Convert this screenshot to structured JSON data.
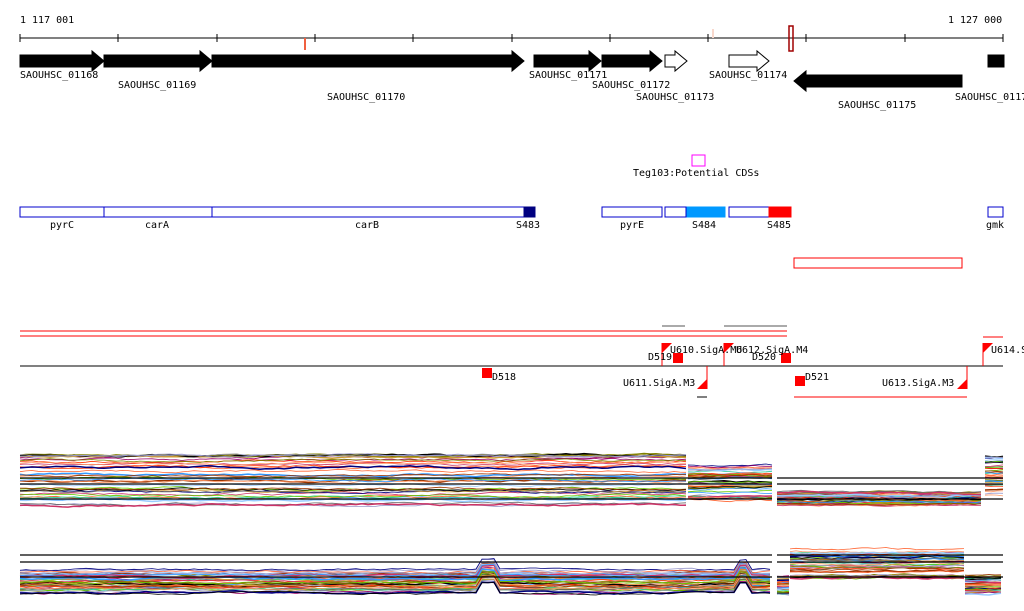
{
  "ruler": {
    "start_label": "1 117 001",
    "end_label": "1 127 000"
  },
  "genes": [
    {
      "label": "SAOUHSC_01168"
    },
    {
      "label": "SAOUHSC_01169"
    },
    {
      "label": "SAOUHSC_01170"
    },
    {
      "label": "SAOUHSC_01171"
    },
    {
      "label": "SAOUHSC_01172"
    },
    {
      "label": "SAOUHSC_01173"
    },
    {
      "label": "SAOUHSC_01174"
    },
    {
      "label": "SAOUHSC_01175"
    },
    {
      "label": "SAOUHSC_0117"
    }
  ],
  "annotation": {
    "label": "Teg103:Potential CDSs",
    "color": "#ff00ff"
  },
  "operons": [
    {
      "label": "pyrC"
    },
    {
      "label": "carA"
    },
    {
      "label": "carB"
    },
    {
      "label": "S483",
      "color": "#000080"
    },
    {
      "label": "pyrE"
    },
    {
      "label": ""
    },
    {
      "label": "S484",
      "color": "#0099ff"
    },
    {
      "label": ""
    },
    {
      "label": "S485",
      "color": "#ff0000"
    },
    {
      "label": "gmk"
    }
  ],
  "features": [
    {
      "label": "D518"
    },
    {
      "label": "D519"
    },
    {
      "label": "U610.SigA.M6"
    },
    {
      "label": "U611.SigA.M3"
    },
    {
      "label": "U612.SigA.M4"
    },
    {
      "label": "D520"
    },
    {
      "label": "D521"
    },
    {
      "label": "U613.SigA.M3"
    },
    {
      "label": "U614.S"
    }
  ],
  "colors": {
    "accent": "#ff0000",
    "outline": "#0000cc"
  }
}
